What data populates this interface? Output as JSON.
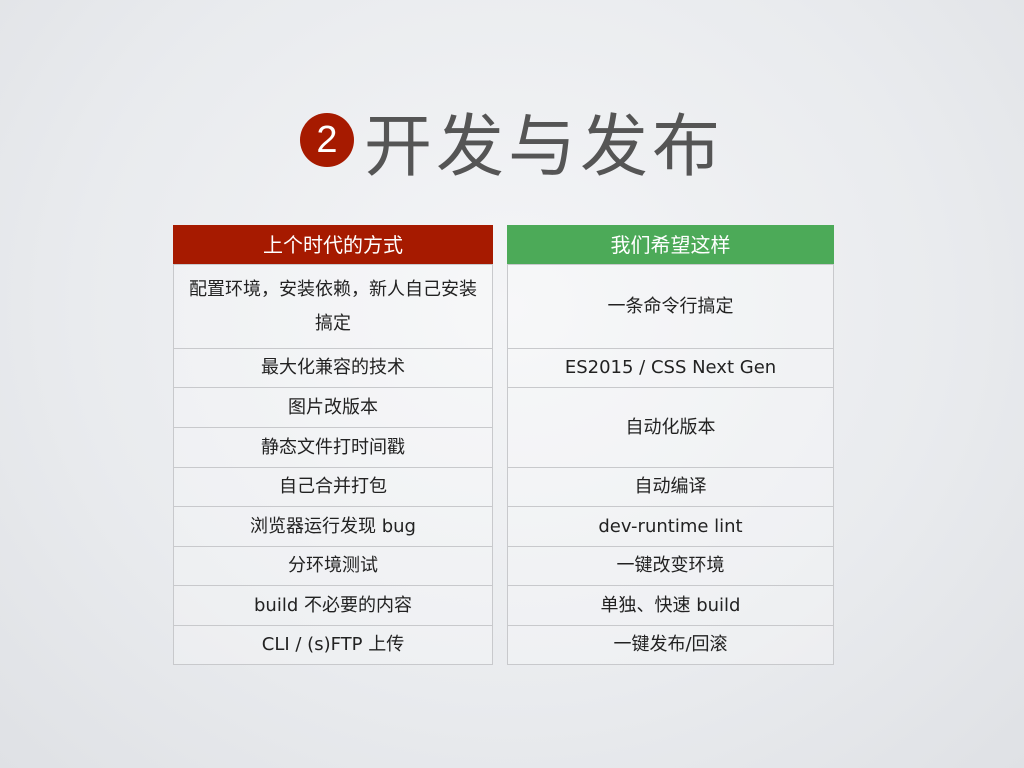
{
  "title": {
    "number": "2",
    "text": "开发与发布"
  },
  "colors": {
    "badge": "#a61a00",
    "left_header": "#a61a00",
    "right_header": "#4caa58"
  },
  "left_table": {
    "header": "上个时代的方式",
    "rows": [
      "配置环境，安装依赖，新人自己安装搞定",
      "最大化兼容的技术",
      "图片改版本",
      "静态文件打时间戳",
      "自己合并打包",
      "浏览器运行发现 bug",
      "分环境测试",
      "build 不必要的内容",
      "CLI / (s)FTP 上传"
    ]
  },
  "right_table": {
    "header": "我们希望这样",
    "rows": [
      "一条命令行搞定",
      "ES2015 / CSS Next Gen",
      "自动化版本",
      "自动编译",
      "dev-runtime lint",
      "一键改变环境",
      "单独、快速 build",
      "一键发布/回滚"
    ]
  }
}
